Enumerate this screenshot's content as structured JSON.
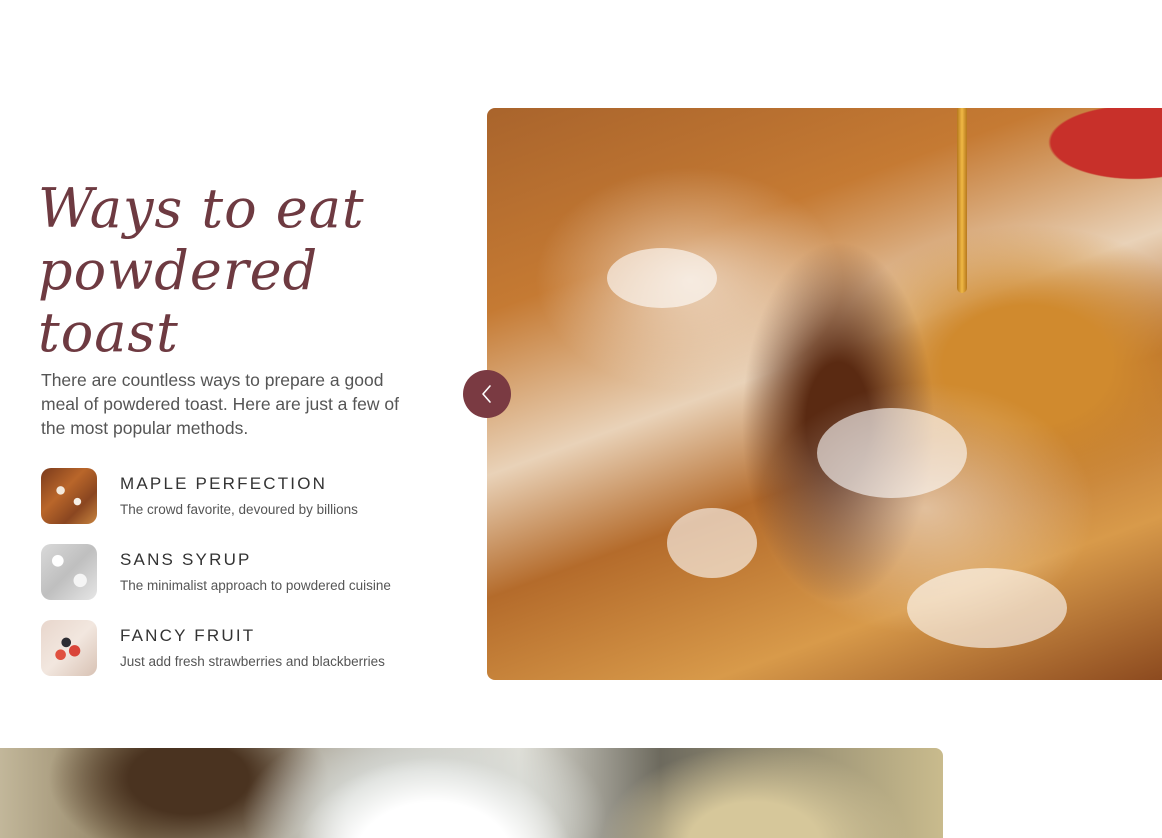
{
  "section": {
    "heading_line1": "Ways to eat",
    "heading_line2": "powdered toast",
    "intro": "There are countless ways to prepare a good meal of powdered toast. Here are just a few of the most popular methods."
  },
  "methods": [
    {
      "title": "MAPLE PERFECTION",
      "description": "The crowd favorite, devoured by billions",
      "icon": "maple-toast-thumbnail"
    },
    {
      "title": "SANS SYRUP",
      "description": "The minimalist approach to powdered cuisine",
      "icon": "plain-toast-thumbnail"
    },
    {
      "title": "FANCY FRUIT",
      "description": "Just add fresh strawberries and blackberries",
      "icon": "fruit-toast-thumbnail"
    }
  ],
  "carousel": {
    "prev_icon": "chevron-left-icon",
    "image": "powdered-french-toast-with-syrup-photo"
  },
  "next_section": {
    "image": "cooking-pan-photo"
  },
  "colors": {
    "accent": "#7a3a42",
    "heading": "#6e3a41",
    "text": "#555555",
    "title": "#333333"
  }
}
